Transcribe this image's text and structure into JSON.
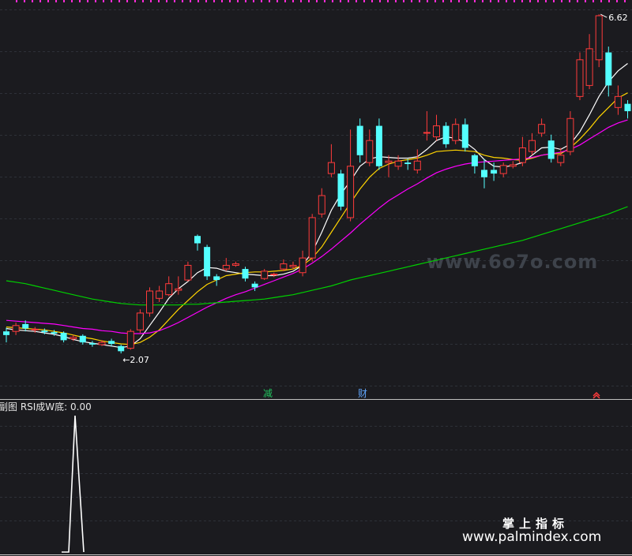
{
  "chart_data": [
    {
      "type": "candlestick",
      "panel": "main",
      "annotations": {
        "low_label": "2.07",
        "high_label": "6.62"
      },
      "markers": [
        {
          "text": "减",
          "color": "#22c55e"
        },
        {
          "text": "财",
          "color": "#60a5fa"
        }
      ],
      "colors": {
        "up": "#ff3b3b",
        "down": "#54ffff",
        "ma_white": "#ffffff",
        "ma_yellow": "#ffd400",
        "ma_magenta": "#ff00ff",
        "ma_green": "#00d000"
      },
      "ylim": [
        1.55,
        6.75
      ],
      "candles": [
        [
          2.3,
          2.25,
          2.35,
          2.15
        ],
        [
          2.3,
          2.38,
          2.42,
          2.25
        ],
        [
          2.4,
          2.34,
          2.45,
          2.3
        ],
        [
          2.32,
          2.33,
          2.36,
          2.28
        ],
        [
          2.31,
          2.29,
          2.34,
          2.26
        ],
        [
          2.29,
          2.27,
          2.32,
          2.24
        ],
        [
          2.28,
          2.18,
          2.3,
          2.15
        ],
        [
          2.2,
          2.22,
          2.25,
          2.17
        ],
        [
          2.24,
          2.15,
          2.26,
          2.12
        ],
        [
          2.14,
          2.12,
          2.17,
          2.09
        ],
        [
          2.12,
          2.15,
          2.18,
          2.1
        ],
        [
          2.17,
          2.13,
          2.2,
          2.1
        ],
        [
          2.1,
          2.03,
          2.12,
          2.0
        ],
        [
          2.07,
          2.3,
          2.33,
          2.05
        ],
        [
          2.32,
          2.55,
          2.6,
          2.28
        ],
        [
          2.55,
          2.85,
          2.9,
          2.5
        ],
        [
          2.75,
          2.85,
          2.92,
          2.7
        ],
        [
          2.8,
          2.95,
          3.05,
          2.78
        ],
        [
          2.86,
          2.88,
          3.05,
          2.8
        ],
        [
          3.0,
          3.2,
          3.25,
          2.98
        ],
        [
          3.6,
          3.5,
          3.62,
          3.4
        ],
        [
          3.45,
          3.05,
          3.48,
          3.0
        ],
        [
          3.05,
          3.0,
          3.08,
          2.92
        ],
        [
          3.15,
          3.2,
          3.3,
          3.12
        ],
        [
          3.2,
          3.22,
          3.25,
          3.18
        ],
        [
          3.15,
          3.02,
          3.18,
          2.98
        ],
        [
          2.95,
          2.9,
          2.98,
          2.85
        ],
        [
          3.02,
          3.12,
          3.15,
          3.0
        ],
        [
          3.07,
          3.08,
          3.1,
          3.04
        ],
        [
          3.15,
          3.22,
          3.28,
          3.12
        ],
        [
          3.18,
          3.2,
          3.25,
          3.15
        ],
        [
          3.1,
          3.3,
          3.4,
          3.05
        ],
        [
          3.3,
          3.85,
          3.9,
          3.25
        ],
        [
          3.9,
          4.15,
          4.25,
          3.85
        ],
        [
          4.45,
          4.6,
          4.85,
          4.4
        ],
        [
          4.45,
          4.0,
          4.5,
          3.95
        ],
        [
          3.85,
          4.55,
          5.05,
          3.8
        ],
        [
          5.1,
          4.7,
          5.2,
          4.6
        ],
        [
          4.6,
          4.9,
          5.05,
          4.55
        ],
        [
          5.1,
          4.55,
          5.2,
          4.5
        ],
        [
          4.6,
          4.62,
          4.7,
          4.4
        ],
        [
          4.55,
          4.62,
          4.7,
          4.5
        ],
        [
          4.6,
          4.58,
          4.65,
          4.5
        ],
        [
          4.5,
          4.62,
          4.78,
          4.45
        ],
        [
          5.0,
          5.01,
          5.3,
          4.9
        ],
        [
          4.95,
          5.1,
          5.25,
          4.9
        ],
        [
          5.1,
          4.85,
          5.15,
          4.8
        ],
        [
          4.9,
          5.12,
          5.2,
          4.85
        ],
        [
          5.12,
          4.8,
          5.2,
          4.75
        ],
        [
          4.7,
          4.55,
          4.72,
          4.45
        ],
        [
          4.5,
          4.4,
          4.65,
          4.25
        ],
        [
          4.5,
          4.45,
          4.6,
          4.35
        ],
        [
          4.45,
          4.56,
          4.6,
          4.4
        ],
        [
          4.55,
          4.57,
          4.62,
          4.52
        ],
        [
          4.6,
          4.8,
          4.95,
          4.55
        ],
        [
          4.75,
          4.9,
          5.0,
          4.7
        ],
        [
          5.0,
          5.12,
          5.2,
          4.95
        ],
        [
          4.9,
          4.65,
          4.98,
          4.6
        ],
        [
          4.6,
          4.7,
          4.8,
          4.55
        ],
        [
          4.75,
          5.2,
          5.3,
          4.7
        ],
        [
          5.5,
          6.0,
          6.1,
          5.45
        ],
        [
          5.65,
          6.15,
          6.35,
          5.6
        ],
        [
          6.0,
          6.6,
          6.62,
          5.9
        ],
        [
          6.1,
          5.65,
          6.18,
          5.5
        ],
        [
          5.35,
          5.5,
          5.65,
          5.25
        ],
        [
          5.4,
          5.3,
          5.45,
          5.2
        ]
      ],
      "series": [
        {
          "color": "#ffffff",
          "values": [
            2.34,
            2.32,
            2.31,
            2.3,
            2.28,
            2.26,
            2.23,
            2.19,
            2.16,
            2.14,
            2.12,
            2.1,
            2.08,
            2.1,
            2.2,
            2.38,
            2.56,
            2.75,
            2.88,
            2.98,
            3.1,
            3.17,
            3.16,
            3.12,
            3.1,
            3.08,
            3.07,
            3.06,
            3.06,
            3.08,
            3.12,
            3.2,
            3.38,
            3.65,
            3.95,
            4.17,
            4.35,
            4.55,
            4.65,
            4.68,
            4.67,
            4.66,
            4.66,
            4.68,
            4.78,
            4.9,
            4.95,
            4.93,
            4.88,
            4.78,
            4.64,
            4.55,
            4.54,
            4.56,
            4.6,
            4.7,
            4.8,
            4.81,
            4.78,
            4.85,
            5.02,
            5.25,
            5.5,
            5.7,
            5.85,
            5.95
          ]
        },
        {
          "color": "#ffd400",
          "values": [
            2.36,
            2.35,
            2.34,
            2.33,
            2.32,
            2.3,
            2.28,
            2.25,
            2.22,
            2.2,
            2.17,
            2.15,
            2.13,
            2.12,
            2.15,
            2.22,
            2.32,
            2.46,
            2.6,
            2.72,
            2.84,
            2.94,
            3.0,
            3.06,
            3.08,
            3.1,
            3.11,
            3.11,
            3.12,
            3.13,
            3.15,
            3.2,
            3.3,
            3.45,
            3.65,
            3.85,
            4.05,
            4.24,
            4.4,
            4.52,
            4.58,
            4.62,
            4.64,
            4.66,
            4.7,
            4.75,
            4.76,
            4.77,
            4.76,
            4.75,
            4.7,
            4.67,
            4.66,
            4.64,
            4.63,
            4.66,
            4.7,
            4.72,
            4.72,
            4.8,
            4.92,
            5.06,
            5.22,
            5.35,
            5.48,
            5.55
          ]
        },
        {
          "color": "#ff00ff",
          "values": [
            2.45,
            2.44,
            2.43,
            2.42,
            2.41,
            2.4,
            2.38,
            2.36,
            2.34,
            2.33,
            2.31,
            2.3,
            2.28,
            2.27,
            2.27,
            2.28,
            2.31,
            2.36,
            2.42,
            2.49,
            2.56,
            2.63,
            2.69,
            2.75,
            2.8,
            2.84,
            2.89,
            2.94,
            2.99,
            3.04,
            3.09,
            3.15,
            3.23,
            3.32,
            3.42,
            3.53,
            3.64,
            3.76,
            3.87,
            3.98,
            4.08,
            4.16,
            4.24,
            4.31,
            4.39,
            4.46,
            4.51,
            4.55,
            4.58,
            4.6,
            4.61,
            4.62,
            4.63,
            4.64,
            4.65,
            4.67,
            4.7,
            4.72,
            4.74,
            4.78,
            4.84,
            4.92,
            5.0,
            5.08,
            5.14,
            5.18
          ]
        },
        {
          "color": "#00d000",
          "values": [
            2.99,
            2.97,
            2.95,
            2.92,
            2.89,
            2.86,
            2.83,
            2.8,
            2.77,
            2.74,
            2.72,
            2.7,
            2.68,
            2.67,
            2.66,
            2.66,
            2.66,
            2.66,
            2.66,
            2.67,
            2.67,
            2.68,
            2.69,
            2.7,
            2.71,
            2.72,
            2.73,
            2.74,
            2.76,
            2.78,
            2.8,
            2.83,
            2.86,
            2.89,
            2.92,
            2.96,
            3.0,
            3.03,
            3.06,
            3.09,
            3.12,
            3.15,
            3.18,
            3.21,
            3.24,
            3.27,
            3.3,
            3.33,
            3.36,
            3.39,
            3.42,
            3.45,
            3.48,
            3.51,
            3.54,
            3.58,
            3.62,
            3.66,
            3.7,
            3.74,
            3.78,
            3.82,
            3.86,
            3.9,
            3.95,
            4.0
          ]
        }
      ]
    },
    {
      "type": "line",
      "panel": "indicator",
      "title": "副图  RSI成W底: 0.00",
      "ylim": [
        0,
        1
      ],
      "x": [
        0,
        1,
        2,
        3
      ],
      "values": [
        0,
        0,
        1,
        0
      ],
      "color": "#ffffff"
    }
  ],
  "watermarks": {
    "main": "www.6o7o.com",
    "cn": "掌上指标",
    "url": "www.palmindex.com"
  }
}
